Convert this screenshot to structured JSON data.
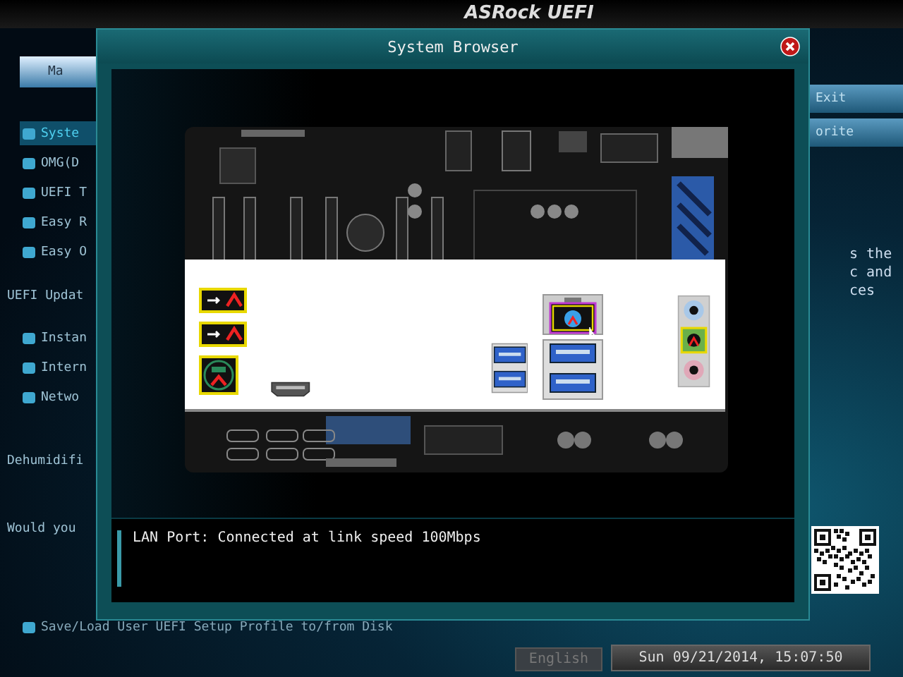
{
  "header": {
    "logo": "ASRock UEFI"
  },
  "left_tab": {
    "label": "Ma"
  },
  "right_tabs": [
    {
      "label": "Exit"
    },
    {
      "label": "orite"
    }
  ],
  "sidebar": {
    "items": [
      {
        "label": "Syste",
        "selected": true
      },
      {
        "label": "OMG(D",
        "selected": false
      },
      {
        "label": "UEFI T",
        "selected": false
      },
      {
        "label": "Easy R",
        "selected": false
      },
      {
        "label": "Easy O",
        "selected": false
      }
    ],
    "section": "UEFI Updat",
    "update_items": [
      {
        "label": "Instan"
      },
      {
        "label": "Intern"
      },
      {
        "label": "Netwo"
      }
    ],
    "dehumidifier": "Dehumidifi",
    "prompt": "Would you",
    "footer_item": "Save/Load User UEFI Setup Profile to/from Disk"
  },
  "description": [
    "s the",
    "c and",
    "ces"
  ],
  "dialog": {
    "title": "System Browser",
    "status": "LAN Port: Connected at link speed 100Mbps"
  },
  "status_bar": {
    "language": "English",
    "datetime": "Sun 09/21/2014, 15:07:50"
  }
}
